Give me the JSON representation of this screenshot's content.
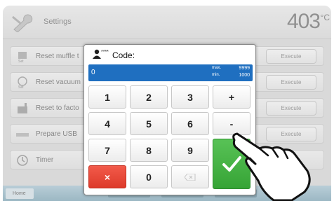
{
  "header": {
    "title": "Settings",
    "temperature": "403",
    "unit": "°C"
  },
  "rows": [
    {
      "label": "Reset muffle t",
      "action": "Execute"
    },
    {
      "label": "Reset vacuum",
      "action": "Execute"
    },
    {
      "label": "Reset to facto",
      "action": "Execute"
    },
    {
      "label": "Prepare USB",
      "action": "Execute"
    },
    {
      "label": "Timer",
      "action": ""
    }
  ],
  "footer": {
    "home_label": "Home"
  },
  "dialog": {
    "title": "Code:",
    "value": "0",
    "max_label": "max.",
    "max_value": "9999",
    "min_label": "min.",
    "min_value": "1000",
    "keys": [
      "1",
      "2",
      "3",
      "+",
      "4",
      "5",
      "6",
      "-",
      "7",
      "8",
      "9",
      "0"
    ],
    "cancel_symbol": "×"
  },
  "colors": {
    "display": "#1f6fc0",
    "cancel": "#e84a3a",
    "confirm": "#48b448"
  }
}
